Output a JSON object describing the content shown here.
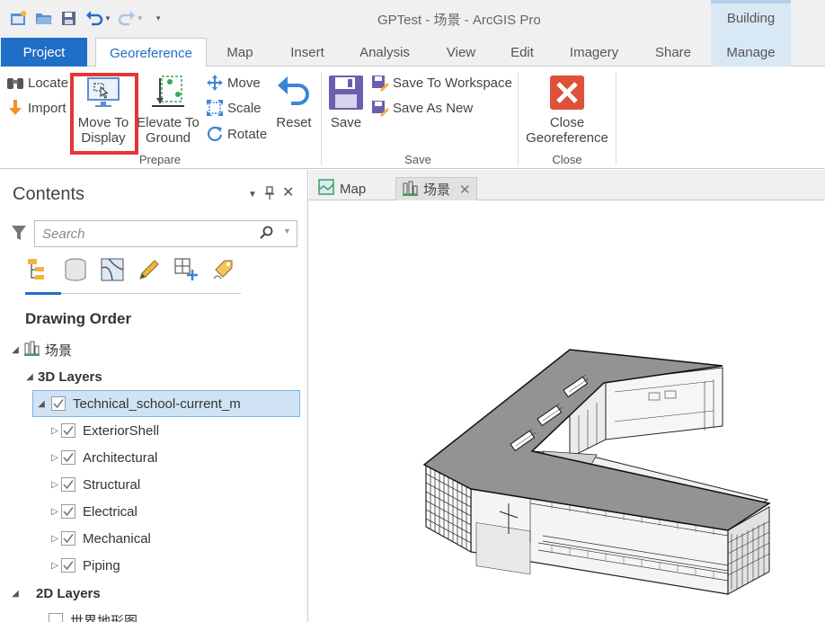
{
  "window": {
    "title": "GPTest - 场景 - ArcGIS Pro",
    "context_group": "Building"
  },
  "tabs": [
    {
      "label": "Project"
    },
    {
      "label": "Georeference"
    },
    {
      "label": "Map"
    },
    {
      "label": "Insert"
    },
    {
      "label": "Analysis"
    },
    {
      "label": "View"
    },
    {
      "label": "Edit"
    },
    {
      "label": "Imagery"
    },
    {
      "label": "Share"
    },
    {
      "label": "Manage"
    }
  ],
  "ribbon": {
    "prepare": {
      "label": "Prepare",
      "locate": "Locate",
      "import": "Import",
      "move_to_display": [
        "Move To",
        "Display"
      ],
      "elevate_to_ground": [
        "Elevate To",
        "Ground"
      ],
      "move": "Move",
      "scale": "Scale",
      "rotate": "Rotate",
      "reset": "Reset"
    },
    "save": {
      "label": "Save",
      "save": "Save",
      "save_to_workspace": "Save To Workspace",
      "save_as_new": "Save As New"
    },
    "close": {
      "label": "Close",
      "close_georeference": [
        "Close",
        "Georeference"
      ]
    }
  },
  "contents": {
    "title": "Contents",
    "search_placeholder": "Search",
    "drawing_order": "Drawing Order",
    "scene_name": "场景",
    "layers_3d_label": "3D Layers",
    "selected_layer": "Technical_school-current_m",
    "sublayers": [
      "ExteriorShell",
      "Architectural",
      "Structural",
      "Electrical",
      "Mechanical",
      "Piping"
    ],
    "layers_2d_label": "2D Layers",
    "partial_layer": "世界地形图"
  },
  "view_tabs": [
    {
      "label": "Map"
    },
    {
      "label": "场景"
    }
  ],
  "colors": {
    "accent": "#1f6fc6",
    "highlight": "#e53535",
    "close_red": "#e0513a",
    "save_purple": "#6b5fad"
  }
}
